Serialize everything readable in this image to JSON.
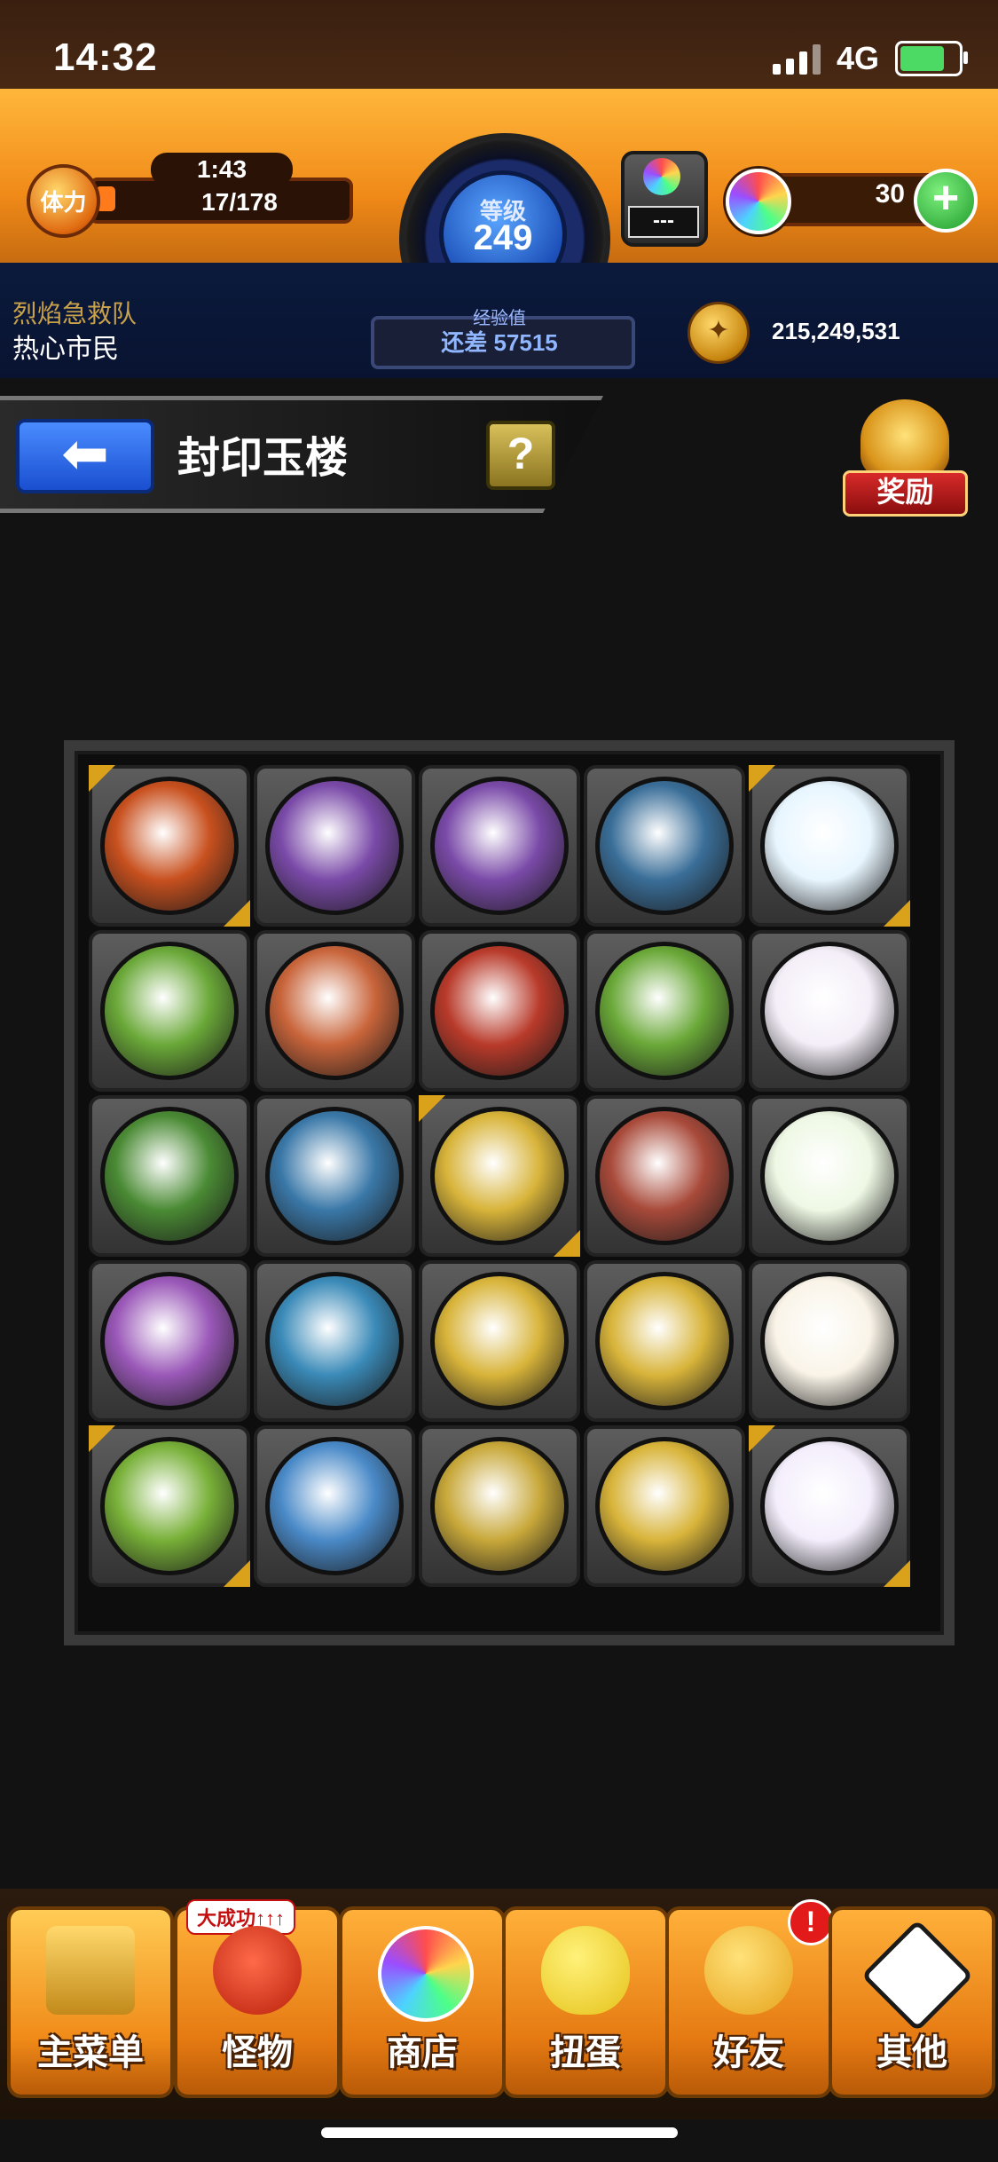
{
  "status_bar": {
    "time": "14:32",
    "network": "4G"
  },
  "header": {
    "stamina_label": "体力",
    "stamina_timer": "1:43",
    "stamina_value": "17/178",
    "level_label": "等级",
    "level_value": "249",
    "gem_box_value": "---",
    "orb_count": "30",
    "exp_label": "经验值",
    "exp_value": "还差 57515",
    "team_name": "烈焰急救队",
    "user_title": "热心市民",
    "coin_value": "215,249,531"
  },
  "page": {
    "title": "封印玉楼",
    "help_label": "?",
    "reward_label": "奖励"
  },
  "grid": {
    "tiles": [
      {
        "color": "#c8501e",
        "gold": true
      },
      {
        "color": "#7a4aa8",
        "gold": false
      },
      {
        "color": "#7a4aa8",
        "gold": false
      },
      {
        "color": "#3a6e98",
        "gold": false
      },
      {
        "color": "#e8f6ff",
        "gold": true
      },
      {
        "color": "#6aa838",
        "gold": false
      },
      {
        "color": "#c8643a",
        "gold": false
      },
      {
        "color": "#b83a2a",
        "gold": false
      },
      {
        "color": "#6aa838",
        "gold": false
      },
      {
        "color": "#f4eef8",
        "gold": false
      },
      {
        "color": "#4a8a34",
        "gold": false
      },
      {
        "color": "#3a78a8",
        "gold": false
      },
      {
        "color": "#d8b43a",
        "gold": true
      },
      {
        "color": "#a84a3a",
        "gold": false
      },
      {
        "color": "#eef8e4",
        "gold": false
      },
      {
        "color": "#9a58b8",
        "gold": false
      },
      {
        "color": "#3a8ab8",
        "gold": false
      },
      {
        "color": "#d8b43a",
        "gold": false
      },
      {
        "color": "#d8b43a",
        "gold": false
      },
      {
        "color": "#faf4e8",
        "gold": false
      },
      {
        "color": "#78b038",
        "gold": true
      },
      {
        "color": "#4a8ac8",
        "gold": false
      },
      {
        "color": "#c8a83a",
        "gold": false
      },
      {
        "color": "#d8b43a",
        "gold": false
      },
      {
        "color": "#f4eefc",
        "gold": true
      }
    ]
  },
  "nav": {
    "home_label": "主菜单",
    "monster_label": "怪物",
    "monster_badge": "大成功↑↑↑",
    "shop_label": "商店",
    "gacha_label": "扭蛋",
    "friends_label": "好友",
    "friends_alert": "!",
    "other_label": "其他"
  },
  "colors": {
    "accent_orange": "#f08a18",
    "navy": "#0b1a3c",
    "level_blue": "#1c4fb8"
  }
}
